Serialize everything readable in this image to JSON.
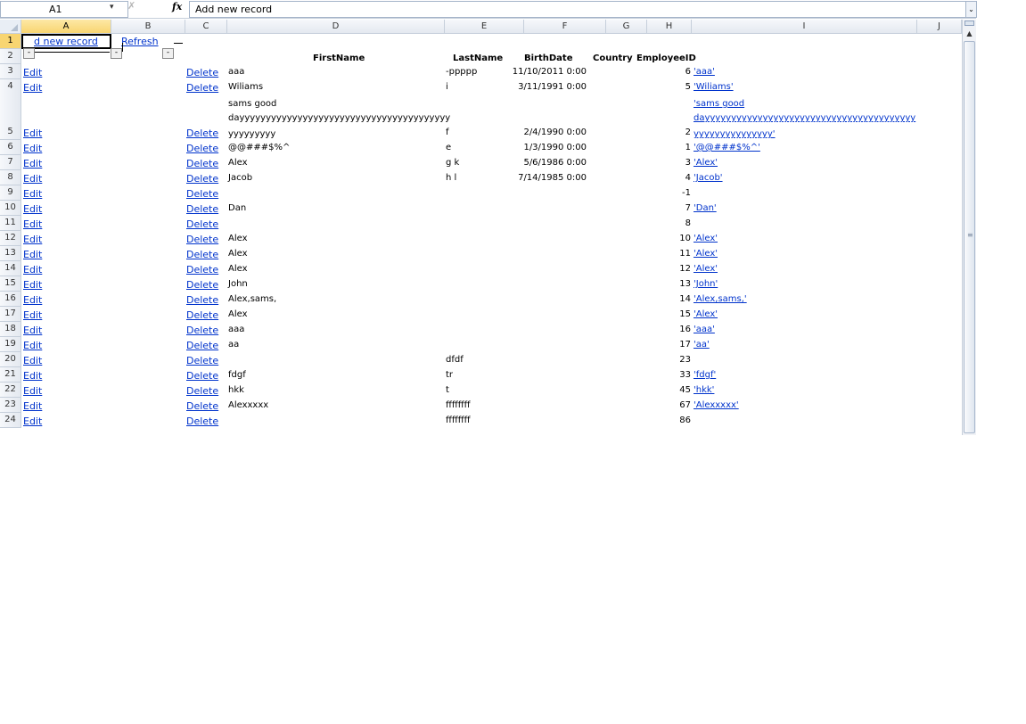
{
  "formula_bar": {
    "name_box": "A1",
    "name_box_arrow": "▾",
    "cancel_glyph": "✗",
    "fx_label": "fx",
    "formula": "Add new record",
    "expand_glyph": "⌄"
  },
  "columns": [
    "A",
    "B",
    "C",
    "D",
    "E",
    "F",
    "G",
    "H",
    "I",
    "J"
  ],
  "rows": [
    "1",
    "2",
    "3",
    "4",
    "",
    "5",
    "6",
    "7",
    "8",
    "9",
    "10",
    "11",
    "12",
    "13",
    "14",
    "15",
    "16",
    "17",
    "18",
    "19",
    "20",
    "21",
    "22",
    "23",
    "24"
  ],
  "row1": {
    "add_new_record": "d new record",
    "refresh": "Refresh",
    "minus": "-"
  },
  "headers": {
    "firstname": "FirstName",
    "lastname": "LastName",
    "birthdate": "BirthDate",
    "country": "Country",
    "employeeid": "EmployeeID"
  },
  "data_rows": [
    {
      "edit": "Edit",
      "delete": "Delete",
      "first": "aaa",
      "last": "-ppppp",
      "birth": "11/10/2011 0:00",
      "id": "6",
      "quoted": "'aaa'"
    },
    {
      "edit": "Edit",
      "delete": "Delete",
      "first": "Wiliams",
      "last": "i",
      "birth": "3/11/1991 0:00",
      "id": "5",
      "quoted": "'Wiliams'"
    },
    {
      "edit": "Edit",
      "delete": "Delete",
      "first_l1": "sams good",
      "first_l2": "dayyyyyyyyyyyyyyyyyyyyyyyyyyyyyyyyyyyyyyyy",
      "first_l3": "yyyyyyyyy",
      "last": "f",
      "birth": "2/4/1990 0:00",
      "id": "2",
      "quoted_l1": "'sams good",
      "quoted_l2": "dayyyyyyyyyyyyyyyyyyyyyyyyyyyyyyyyyyyyyyyy",
      "quoted_l3": "yyyyyyyyyyyyyyy'"
    },
    {
      "edit": "Edit",
      "delete": "Delete",
      "first": "@@###$%^",
      "last": "e",
      "birth": "1/3/1990 0:00",
      "id": "1",
      "quoted": "'@@###$%^'"
    },
    {
      "edit": "Edit",
      "delete": "Delete",
      "first": "Alex",
      "last": "g k",
      "birth": "5/6/1986 0:00",
      "id": "3",
      "quoted": "'Alex'"
    },
    {
      "edit": "Edit",
      "delete": "Delete",
      "first": "Jacob",
      "last": "h l",
      "birth": "7/14/1985 0:00",
      "id": "4",
      "quoted": "'Jacob'"
    },
    {
      "edit": "Edit",
      "delete": "Delete",
      "first": "",
      "last": "",
      "birth": "",
      "id": "-1",
      "quoted": ""
    },
    {
      "edit": "Edit",
      "delete": "Delete",
      "first": "Dan",
      "last": "",
      "birth": "",
      "id": "7",
      "quoted": "'Dan'"
    },
    {
      "edit": "Edit",
      "delete": "Delete",
      "first": "",
      "last": "",
      "birth": "",
      "id": "8",
      "quoted": ""
    },
    {
      "edit": "Edit",
      "delete": "Delete",
      "first": "Alex",
      "last": "",
      "birth": "",
      "id": "10",
      "quoted": "'Alex'"
    },
    {
      "edit": "Edit",
      "delete": "Delete",
      "first": "Alex",
      "last": "",
      "birth": "",
      "id": "11",
      "quoted": "'Alex'"
    },
    {
      "edit": "Edit",
      "delete": "Delete",
      "first": "Alex",
      "last": "",
      "birth": "",
      "id": "12",
      "quoted": "'Alex'"
    },
    {
      "edit": "Edit",
      "delete": "Delete",
      "first": "John",
      "last": "",
      "birth": "",
      "id": "13",
      "quoted": "'John'"
    },
    {
      "edit": "Edit",
      "delete": "Delete",
      "first": "Alex,sams,",
      "last": "",
      "birth": "",
      "id": "14",
      "quoted": "'Alex,sams,'"
    },
    {
      "edit": "Edit",
      "delete": "Delete",
      "first": "Alex",
      "last": "",
      "birth": "",
      "id": "15",
      "quoted": "'Alex'"
    },
    {
      "edit": "Edit",
      "delete": "Delete",
      "first": "aaa",
      "last": "",
      "birth": "",
      "id": "16",
      "quoted": "'aaa'"
    },
    {
      "edit": "Edit",
      "delete": "Delete",
      "first": "aa",
      "last": "",
      "birth": "",
      "id": "17",
      "quoted": "'aa'"
    },
    {
      "edit": "Edit",
      "delete": "Delete",
      "first": "",
      "last": "dfdf",
      "birth": "",
      "id": "23",
      "quoted": ""
    },
    {
      "edit": "Edit",
      "delete": "Delete",
      "first": "fdgf",
      "last": "tr",
      "birth": "",
      "id": "33",
      "quoted": "'fdgf'"
    },
    {
      "edit": "Edit",
      "delete": "Delete",
      "first": "hkk",
      "last": "t",
      "birth": "",
      "id": "45",
      "quoted": "'hkk'"
    },
    {
      "edit": "Edit",
      "delete": "Delete",
      "first": "Alexxxxx",
      "last": "ffffffff",
      "birth": "",
      "id": "67",
      "quoted": "'Alexxxxx'"
    },
    {
      "edit": "Edit",
      "delete": "Delete",
      "first": "",
      "last": "ffffffff",
      "birth": "",
      "id": "86",
      "quoted": ""
    }
  ],
  "scrollbar": {
    "up_glyph": "▲",
    "grip_glyph": "≡"
  },
  "colors": {
    "link": "#0033cc",
    "selected_header": "#f8d571",
    "grid_border": "#c6cfdb"
  }
}
